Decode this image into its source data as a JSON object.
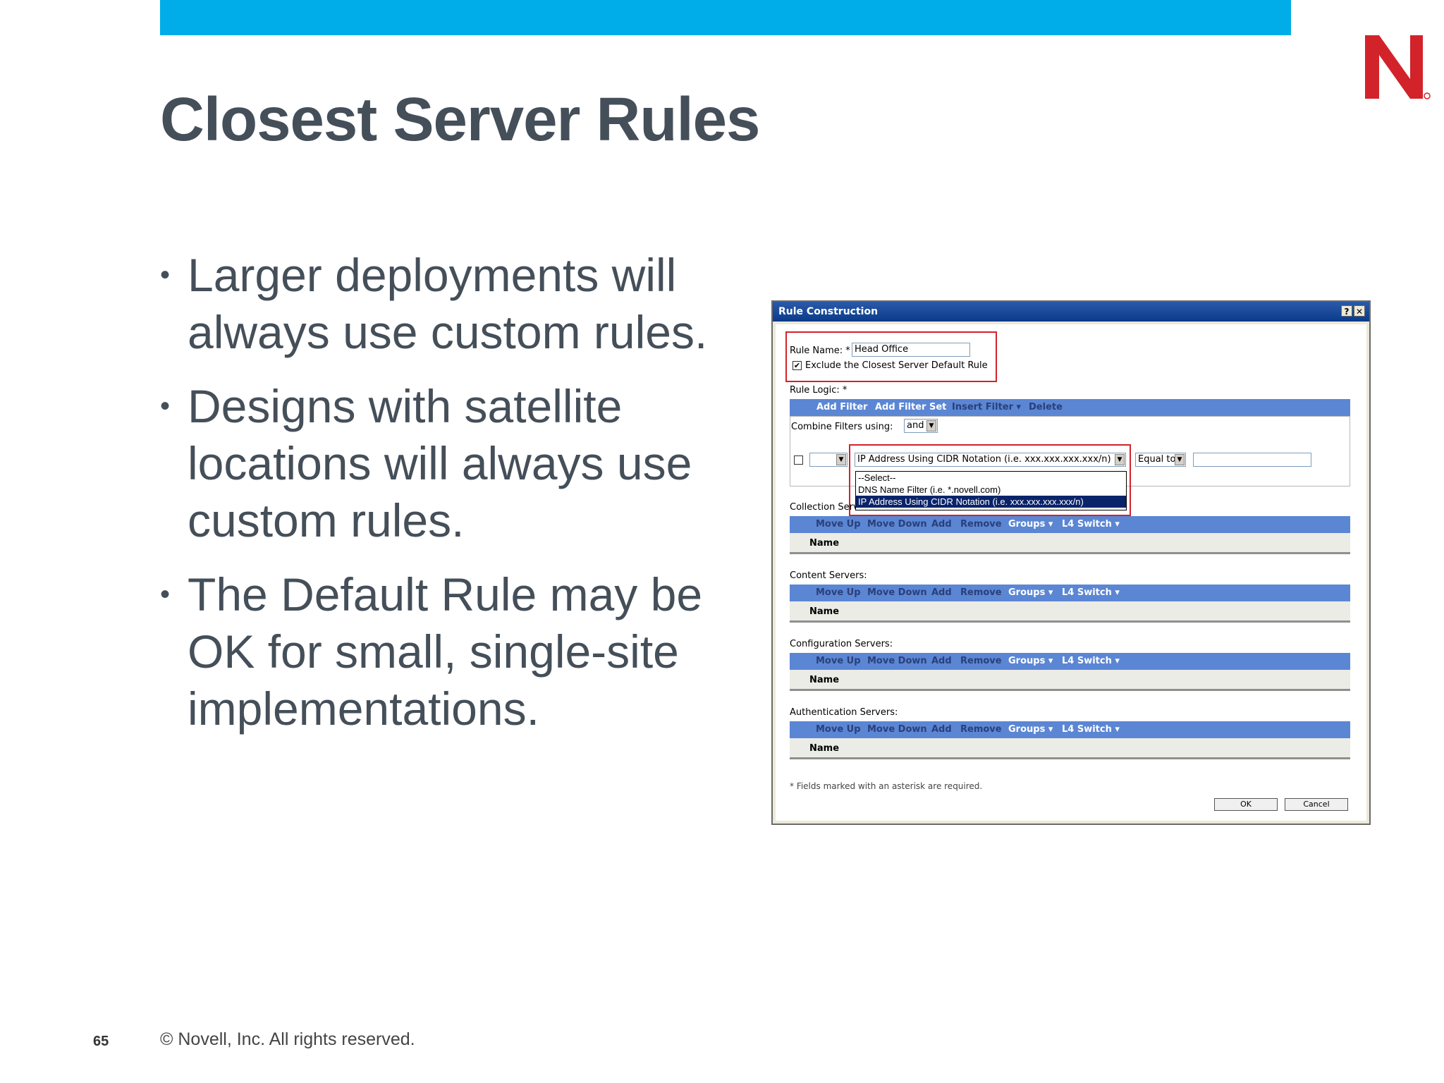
{
  "slide": {
    "title": "Closest Server Rules",
    "bullets": [
      "Larger deployments will always use custom rules.",
      "Designs with satellite locations will always use custom rules.",
      "The Default Rule may be OK for small, single-site implementations."
    ],
    "bullet_glyph": "•",
    "footer_page": "65",
    "footer_copyright": "©  Novell, Inc.  All rights reserved.",
    "accent_color": "#00ade9",
    "logo_color": "#d2232a"
  },
  "dialog": {
    "title": "Rule Construction",
    "help_glyph": "?",
    "close_glyph": "✕",
    "rule_name_label": "Rule Name: *",
    "rule_name_value": "Head Office",
    "exclude_checked": "✔",
    "exclude_label": "Exclude the Closest Server Default Rule",
    "rule_logic_label": "Rule Logic: *",
    "logic_toolbar": [
      "Add Filter",
      "Add Filter Set",
      "Insert Filter ▾",
      "Delete"
    ],
    "combine_label": "Combine Filters using:",
    "combine_value": "and",
    "filter_type_value": "IP Address Using CIDR Notation (i.e. xxx.xxx.xxx.xxx/n)",
    "operator_value": "Equal to",
    "dropdown_options": [
      "--Select--",
      "DNS Name Filter (i.e. *.novell.com)",
      "IP Address Using CIDR Notation (i.e. xxx.xxx.xxx.xxx/n)"
    ],
    "server_toolbar": [
      "Move Up",
      "Move Down",
      "Add",
      "Remove",
      "Groups ▾",
      "L4 Switch ▾"
    ],
    "name_column": "Name",
    "sections": [
      "Collection Servers:",
      "Content Servers:",
      "Configuration Servers:",
      "Authentication Servers:"
    ],
    "required_note": "* Fields marked with an asterisk are required.",
    "ok_label": "OK",
    "cancel_label": "Cancel"
  }
}
